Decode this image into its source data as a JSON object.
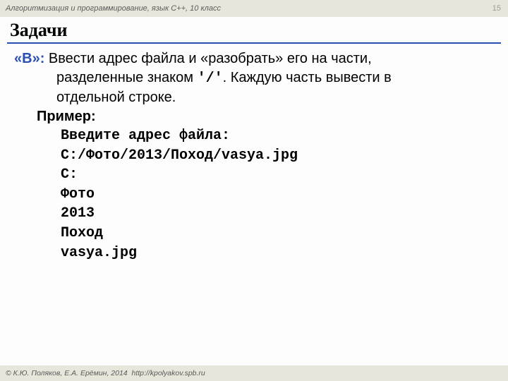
{
  "header": {
    "course": "Алгоритмизация и программирование, язык C++, 10 класс",
    "page": "15"
  },
  "title": "Задачи",
  "task": {
    "tag": "«B»:",
    "desc_first": " Ввести адрес файла и «разобрать» его на части,",
    "desc_cont_1": "разделенные знаком ",
    "slash": "'/'",
    "desc_cont_2": ". Каждую часть вывести в",
    "desc_cont_3": "отдельной строке.",
    "example_label": "Пример:",
    "lines": [
      "Введите адрес файла:",
      "C:/Фото/2013/Поход/vasya.jpg",
      "C:",
      "Фото",
      "2013",
      "Поход",
      "vasya.jpg"
    ]
  },
  "footer": {
    "copyright": "© К.Ю. Поляков, Е.А. Ерёмин, 2014",
    "url": "http://kpolyakov.spb.ru"
  }
}
